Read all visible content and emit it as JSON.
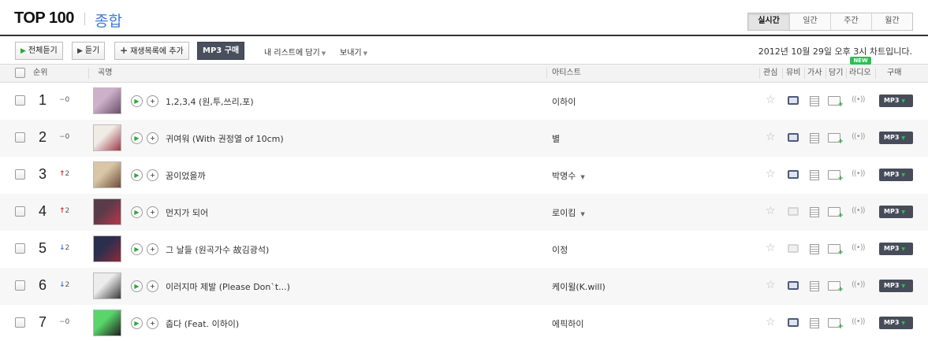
{
  "header": {
    "title": "TOP 100",
    "subtitle": "종합",
    "period_tabs": [
      "실시간",
      "일간",
      "주간",
      "월간"
    ],
    "active_tab": "실시간"
  },
  "toolbar": {
    "play_all": "전체듣기",
    "play": "듣기",
    "add_playlist": "재생목록에 추가",
    "mp3_buy": "MP3 구매",
    "add_to_my_list": "내 리스트에 담기",
    "send": "보내기",
    "chart_notice": "2012년 10월 29일 오후 3시 차트입니다."
  },
  "table_header": {
    "rank": "순위",
    "song": "곡명",
    "artist": "아티스트",
    "like": "관심",
    "mv": "뮤비",
    "lyrics": "가사",
    "save": "담기",
    "radio": "라디오",
    "buy": "구매",
    "new_badge": "NEW"
  },
  "rows": [
    {
      "rank": "1",
      "change_dir": "same",
      "change": "0",
      "title": "1,2,3,4 (원,투,쓰리,포)",
      "artist": "이하이",
      "artist_menu": false,
      "mv_available": true,
      "mp3": "MP3",
      "thumb_colors": [
        "#cdb0c9",
        "#6b4f6a"
      ]
    },
    {
      "rank": "2",
      "change_dir": "same",
      "change": "0",
      "title": "귀여워 (With 권정열 of 10cm)",
      "artist": "별",
      "artist_menu": false,
      "mv_available": true,
      "mp3": "MP3",
      "thumb_colors": [
        "#f1ebe6",
        "#9a3a46"
      ]
    },
    {
      "rank": "3",
      "change_dir": "up",
      "change": "2",
      "title": "꿈이었을까",
      "artist": "박명수",
      "artist_menu": true,
      "mv_available": true,
      "mp3": "MP3",
      "thumb_colors": [
        "#d8c6a6",
        "#6e4b3a"
      ]
    },
    {
      "rank": "4",
      "change_dir": "up",
      "change": "2",
      "title": "먼지가 되어",
      "artist": "로이킴",
      "artist_menu": true,
      "mv_available": false,
      "mp3": "MP3",
      "thumb_colors": [
        "#5a3b4a",
        "#b8364a"
      ]
    },
    {
      "rank": "5",
      "change_dir": "down",
      "change": "2",
      "title": "그 날들 (원곡가수 故김광석)",
      "artist": "이정",
      "artist_menu": false,
      "mv_available": false,
      "mp3": "MP3",
      "thumb_colors": [
        "#2b2f4e",
        "#8c2a3a"
      ]
    },
    {
      "rank": "6",
      "change_dir": "down",
      "change": "2",
      "title": "이러지마 제발 (Please Don`t...)",
      "artist": "케이윌(K.will)",
      "artist_menu": false,
      "mv_available": true,
      "mp3": "MP3",
      "thumb_colors": [
        "#ececec",
        "#3a3a3a"
      ]
    },
    {
      "rank": "7",
      "change_dir": "same",
      "change": "0",
      "title": "춥다 (Feat. 이하이)",
      "artist": "에픽하이",
      "artist_menu": false,
      "mv_available": true,
      "mp3": "MP3",
      "thumb_colors": [
        "#59d56a",
        "#1f1f1f"
      ]
    }
  ],
  "colors": {
    "accent_blue": "#3a7bd5",
    "rank_up": "#e0282e",
    "rank_down": "#3a78d4",
    "play_green": "#2aa83a",
    "mp3_button": "#474c5a",
    "new_badge": "#2bbf53"
  }
}
